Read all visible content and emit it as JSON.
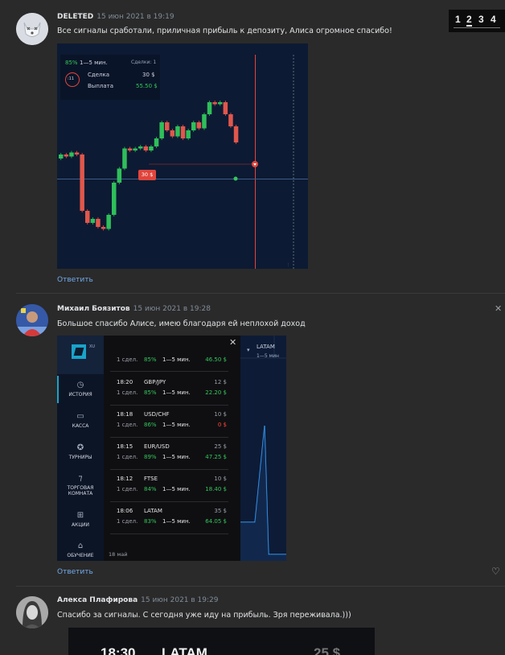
{
  "pager": {
    "pages": [
      "1",
      "2",
      "3",
      "4"
    ],
    "current": "2"
  },
  "comments": [
    {
      "author": "DELETED",
      "date": "15 июн 2021 в 19:19",
      "text": "Все сигналы сработали, приличная прибыль к депозиту, Алиса огромное спасибо!",
      "reply": "Ответить"
    },
    {
      "author": "Михаил Боязитов",
      "date": "15 июн 2021 в 19:28",
      "text": "Большое спасибо Алисе, имею благодаря ей неплохой доход",
      "reply": "Ответить"
    },
    {
      "author": "Алекса Плафирова",
      "date": "15 июн 2021 в 19:29",
      "text": "Спасибо за сигналы. С сегодня уже иду на прибыль. Зря переживала.)))"
    }
  ],
  "trade_card": {
    "percent": "85%",
    "duration": "1—5 мин.",
    "deals_label": "Сделки: 1",
    "timer": ":11",
    "deal_label": "Сделка",
    "deal_value": "30 $",
    "payout_label": "Выплата",
    "payout_value": "55.50 $",
    "marker_label": "30 $"
  },
  "candles": [
    {
      "o": 50,
      "c": 52
    },
    {
      "o": 52,
      "c": 51
    },
    {
      "o": 51,
      "c": 53
    },
    {
      "o": 53,
      "c": 52
    },
    {
      "o": 52,
      "c": 24
    },
    {
      "o": 24,
      "c": 18
    },
    {
      "o": 18,
      "c": 20
    },
    {
      "o": 20,
      "c": 16
    },
    {
      "o": 16,
      "c": 15
    },
    {
      "o": 15,
      "c": 22
    },
    {
      "o": 22,
      "c": 38
    },
    {
      "o": 38,
      "c": 45
    },
    {
      "o": 45,
      "c": 55
    },
    {
      "o": 55,
      "c": 54
    },
    {
      "o": 54,
      "c": 55
    },
    {
      "o": 55,
      "c": 56
    },
    {
      "o": 56,
      "c": 54
    },
    {
      "o": 54,
      "c": 56
    },
    {
      "o": 56,
      "c": 60
    },
    {
      "o": 60,
      "c": 68
    },
    {
      "o": 68,
      "c": 64
    },
    {
      "o": 64,
      "c": 61
    },
    {
      "o": 61,
      "c": 66
    },
    {
      "o": 66,
      "c": 60
    },
    {
      "o": 60,
      "c": 64
    },
    {
      "o": 64,
      "c": 68
    },
    {
      "o": 68,
      "c": 65
    },
    {
      "o": 65,
      "c": 72
    },
    {
      "o": 72,
      "c": 78
    },
    {
      "o": 78,
      "c": 77
    },
    {
      "o": 77,
      "c": 78
    },
    {
      "o": 78,
      "c": 72
    },
    {
      "o": 72,
      "c": 66
    },
    {
      "o": 66,
      "c": 58
    }
  ],
  "history_app": {
    "logo_suffix": "XU",
    "first_row": {
      "deals": "1 сдел.",
      "percent": "85%",
      "duration": "1—5 мин.",
      "payout": "46.50 $"
    },
    "sidebar": [
      "ИСТОРИЯ",
      "КАССА",
      "ТУРНИРЫ",
      "ТОРГОВАЯ КОМНАТА",
      "АКЦИИ",
      "ОБУЧЕНИЕ"
    ],
    "trades": [
      {
        "time": "18:20",
        "asset": "GBP/JPY",
        "amount": "12 $",
        "deals": "1 сдел.",
        "percent": "85%",
        "duration": "1—5 мин.",
        "payout": "22.20 $",
        "payout_color": "#35c759"
      },
      {
        "time": "18:18",
        "asset": "USD/CHF",
        "amount": "10 $",
        "deals": "1 сдел.",
        "percent": "86%",
        "duration": "1—5 мин.",
        "payout": "0 $",
        "payout_color": "#ff453a"
      },
      {
        "time": "18:15",
        "asset": "EUR/USD",
        "amount": "25 $",
        "deals": "1 сдел.",
        "percent": "89%",
        "duration": "1—5 мин.",
        "payout": "47.25 $",
        "payout_color": "#35c759"
      },
      {
        "time": "18:12",
        "asset": "FTSE",
        "amount": "10 $",
        "deals": "1 сдел.",
        "percent": "84%",
        "duration": "1—5 мин.",
        "payout": "18.40 $",
        "payout_color": "#35c759"
      },
      {
        "time": "18:06",
        "asset": "LATAM",
        "amount": "35 $",
        "deals": "1 сдел.",
        "percent": "83%",
        "duration": "1—5 мин.",
        "payout": "64.05 $",
        "payout_color": "#35c759"
      }
    ],
    "date_label": "18 май",
    "right_asset": "LATAM",
    "right_duration": "1—5 мин"
  },
  "third_image": {
    "time": "18:30",
    "asset": "LATAM",
    "amount": "25 $"
  }
}
